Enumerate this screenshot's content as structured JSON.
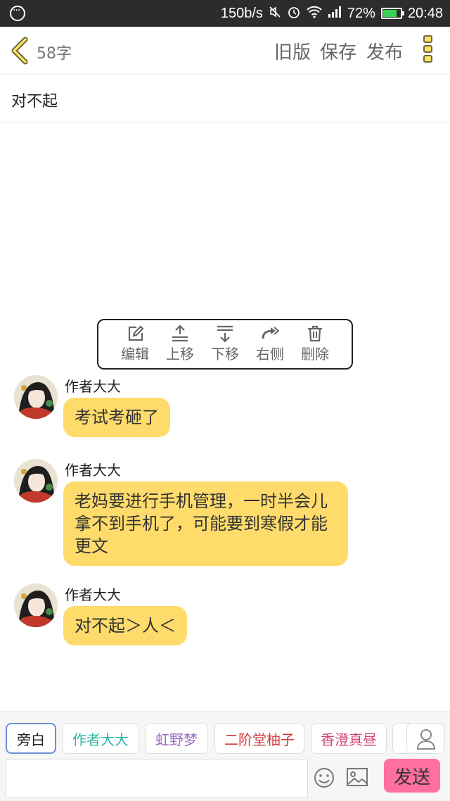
{
  "status_bar": {
    "speed": "150b/s",
    "battery": "72%",
    "time": "20:48"
  },
  "top_bar": {
    "word_count": "58字",
    "old_version": "旧版",
    "save": "保存",
    "publish": "发布"
  },
  "title": "对不起",
  "toolbar": {
    "items": [
      {
        "label": "编辑",
        "icon": "edit-icon"
      },
      {
        "label": "上移",
        "icon": "move-up-icon"
      },
      {
        "label": "下移",
        "icon": "move-down-icon"
      },
      {
        "label": "右侧",
        "icon": "right-side-icon"
      },
      {
        "label": "删除",
        "icon": "delete-icon"
      }
    ]
  },
  "messages": [
    {
      "sender": "作者大大",
      "text": "考试考砸了"
    },
    {
      "sender": "作者大大",
      "text": "老妈要进行手机管理，一时半会儿拿不到手机了，可能要到寒假才能更文"
    },
    {
      "sender": "作者大大",
      "text": "对不起＞人＜"
    }
  ],
  "characters": [
    {
      "label": "旁白",
      "color": "#333333"
    },
    {
      "label": "作者大大",
      "color": "#2bb5a8"
    },
    {
      "label": "虹野梦",
      "color": "#9a6cc2"
    },
    {
      "label": "二阶堂柚子",
      "color": "#d23a3a"
    },
    {
      "label": "香澄真昼",
      "color": "#d2457a"
    }
  ],
  "input": {
    "send_label": "发送"
  },
  "colors": {
    "bubble": "#fedb6b",
    "send_button": "#ff6fa0",
    "accent_yellow": "#ffe066"
  }
}
